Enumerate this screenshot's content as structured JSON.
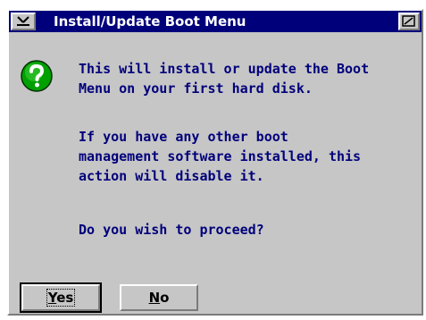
{
  "window": {
    "title": "Install/Update Boot Menu"
  },
  "icons": {
    "system_menu": "system-menu-icon",
    "resize": "resize-icon",
    "message": "question-mark-icon"
  },
  "message": {
    "paragraph1_line1": "This will install or update the Boot",
    "paragraph1_line2": "Menu on your first hard disk.",
    "paragraph2_line1": "If you have any other boot",
    "paragraph2_line2": "management software installed, this",
    "paragraph2_line3": "action will disable it.",
    "question": "Do you wish to proceed?"
  },
  "buttons": {
    "yes_mnemonic": "Y",
    "yes_rest": "es",
    "no_mnemonic": "N",
    "no_rest": "o"
  },
  "colors": {
    "titlebar": "#00007b",
    "window_face": "#c6c6c6",
    "text": "#00007b",
    "icon_green": "#00a000"
  }
}
